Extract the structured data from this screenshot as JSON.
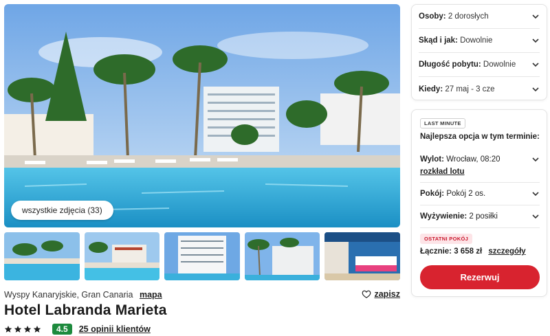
{
  "gallery": {
    "all_photos_label": "wszystkie zdjęcia (33)",
    "thumbnails": [
      "pool-view",
      "pool-lounge",
      "hotel-facade",
      "palms-building",
      "hotel-room"
    ]
  },
  "hotel": {
    "location": "Wyspy Kanaryjskie, Gran Canaria",
    "map_label": "mapa",
    "save_label": "zapisz",
    "name": "Hotel Labranda Marieta",
    "stars": 4,
    "score": "4.5",
    "reviews_label": "25 opinii klientów"
  },
  "filters": [
    {
      "label": "Osoby:",
      "value": "2 dorosłych"
    },
    {
      "label": "Skąd i jak:",
      "value": "Dowolnie"
    },
    {
      "label": "Długość pobytu:",
      "value": "Dowolnie"
    },
    {
      "label": "Kiedy:",
      "value": "27 maj - 3 cze"
    }
  ],
  "offer": {
    "badge": "LAST MINUTE",
    "heading": "Najlepsza opcja w tym terminie:",
    "flight_label": "Wylot:",
    "flight_value": "Wrocław, 08:20",
    "flight_schedule": "rozkład lotu",
    "room_label": "Pokój:",
    "room_value": "Pokój 2 os.",
    "meal_label": "Wyżywienie:",
    "meal_value": "2 posiłki",
    "last_room_badge": "OSTATNI POKÓJ",
    "total_label": "Łącznie:",
    "total_value": "3 658 zł",
    "details_label": "szczegóły",
    "book_label": "Rezerwuj"
  },
  "colors": {
    "accent": "#d8232f",
    "score_green": "#1d8a3d",
    "last_room_bg": "#fde4e7"
  }
}
